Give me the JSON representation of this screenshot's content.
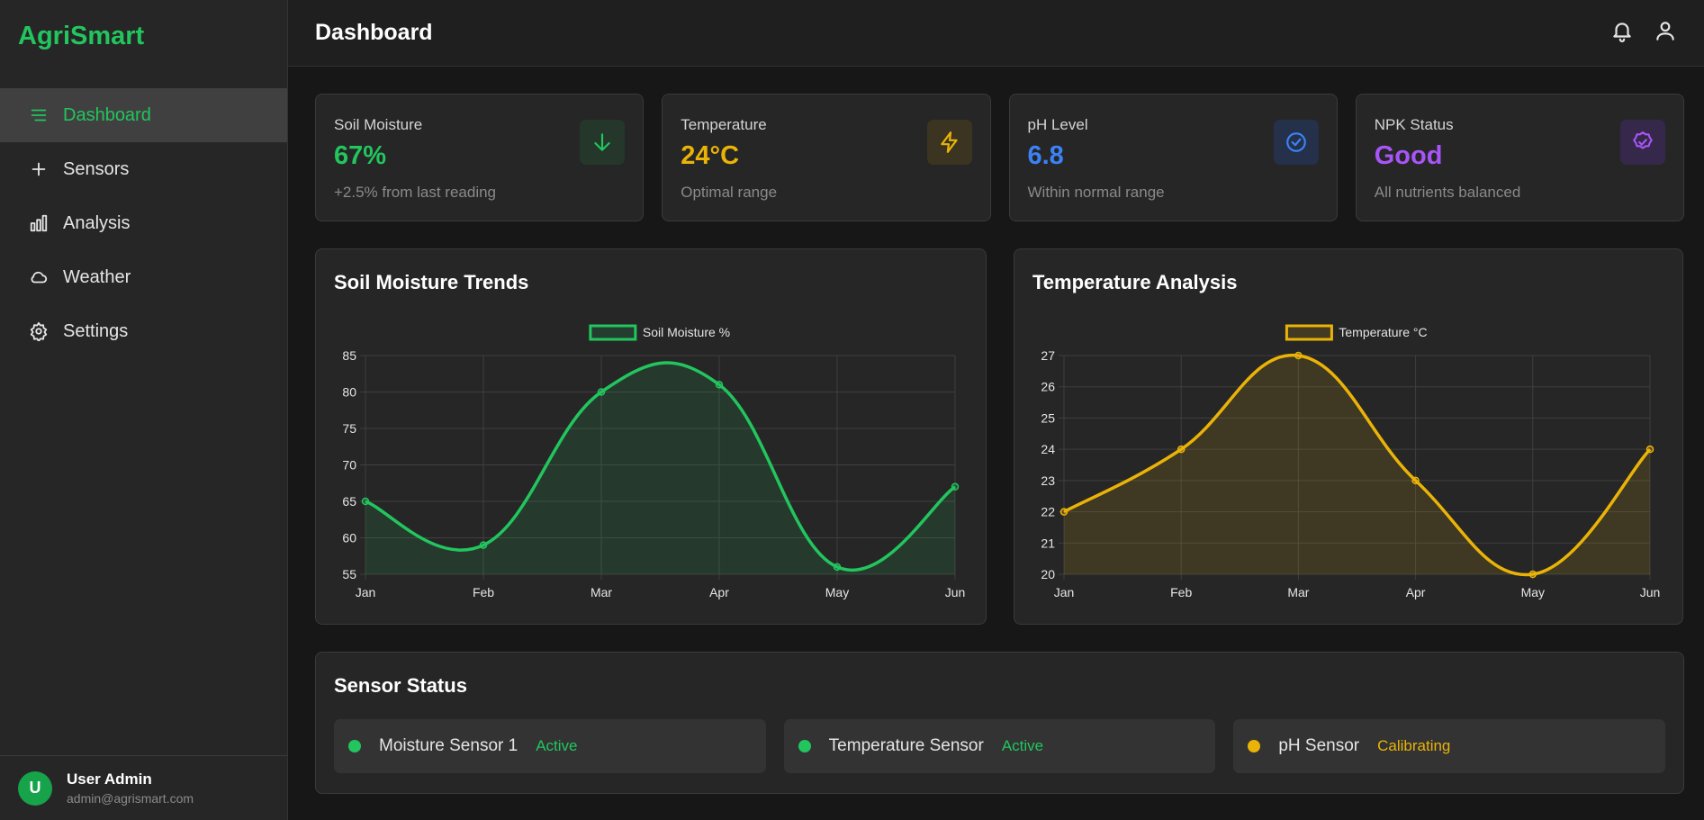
{
  "sidebar": {
    "brand": "AgriSmart",
    "items": [
      {
        "label": "Dashboard",
        "icon": "menu-icon"
      },
      {
        "label": "Sensors",
        "icon": "plus-icon"
      },
      {
        "label": "Analysis",
        "icon": "bar-chart-icon"
      },
      {
        "label": "Weather",
        "icon": "cloud-icon"
      },
      {
        "label": "Settings",
        "icon": "gear-icon"
      }
    ],
    "user": {
      "initial": "U",
      "name": "User Admin",
      "email": "admin@agrismart.com"
    }
  },
  "header": {
    "title": "Dashboard"
  },
  "stats": [
    {
      "label": "Soil Moisture",
      "value": "67%",
      "sub": "+2.5% from last reading",
      "color": "#22c55e",
      "icon": "arrow-down-icon"
    },
    {
      "label": "Temperature",
      "value": "24°C",
      "sub": "Optimal range",
      "color": "#eab308",
      "icon": "lightning-icon"
    },
    {
      "label": "pH Level",
      "value": "6.8",
      "sub": "Within normal range",
      "color": "#3b82f6",
      "icon": "check-circle-icon"
    },
    {
      "label": "NPK Status",
      "value": "Good",
      "sub": "All nutrients balanced",
      "color": "#a855f7",
      "icon": "badge-check-icon"
    }
  ],
  "chart_titles": [
    "Soil Moisture Trends",
    "Temperature Analysis"
  ],
  "chart_data": [
    {
      "type": "line",
      "title": "Soil Moisture Trends",
      "categories": [
        "Jan",
        "Feb",
        "Mar",
        "Apr",
        "May",
        "Jun"
      ],
      "series": [
        {
          "name": "Soil Moisture %",
          "values": [
            65,
            59,
            80,
            81,
            56,
            67
          ]
        }
      ],
      "ylim": [
        55,
        85
      ],
      "yticks": [
        55,
        60,
        65,
        70,
        75,
        80,
        85
      ],
      "color": "#22c55e",
      "fill": true,
      "grid": true,
      "legend": "top-center"
    },
    {
      "type": "line",
      "title": "Temperature Analysis",
      "categories": [
        "Jan",
        "Feb",
        "Mar",
        "Apr",
        "May",
        "Jun"
      ],
      "series": [
        {
          "name": "Temperature °C",
          "values": [
            22,
            24,
            27,
            23,
            20,
            24
          ]
        }
      ],
      "ylim": [
        20,
        27
      ],
      "yticks": [
        20,
        21,
        22,
        23,
        24,
        25,
        26,
        27
      ],
      "color": "#eab308",
      "fill": true,
      "grid": true,
      "legend": "top-center"
    }
  ],
  "sensors": {
    "title": "Sensor Status",
    "items": [
      {
        "name": "Moisture Sensor 1",
        "status": "Active",
        "color": "#22c55e"
      },
      {
        "name": "Temperature Sensor",
        "status": "Active",
        "color": "#22c55e"
      },
      {
        "name": "pH Sensor",
        "status": "Calibrating",
        "color": "#eab308"
      }
    ]
  }
}
